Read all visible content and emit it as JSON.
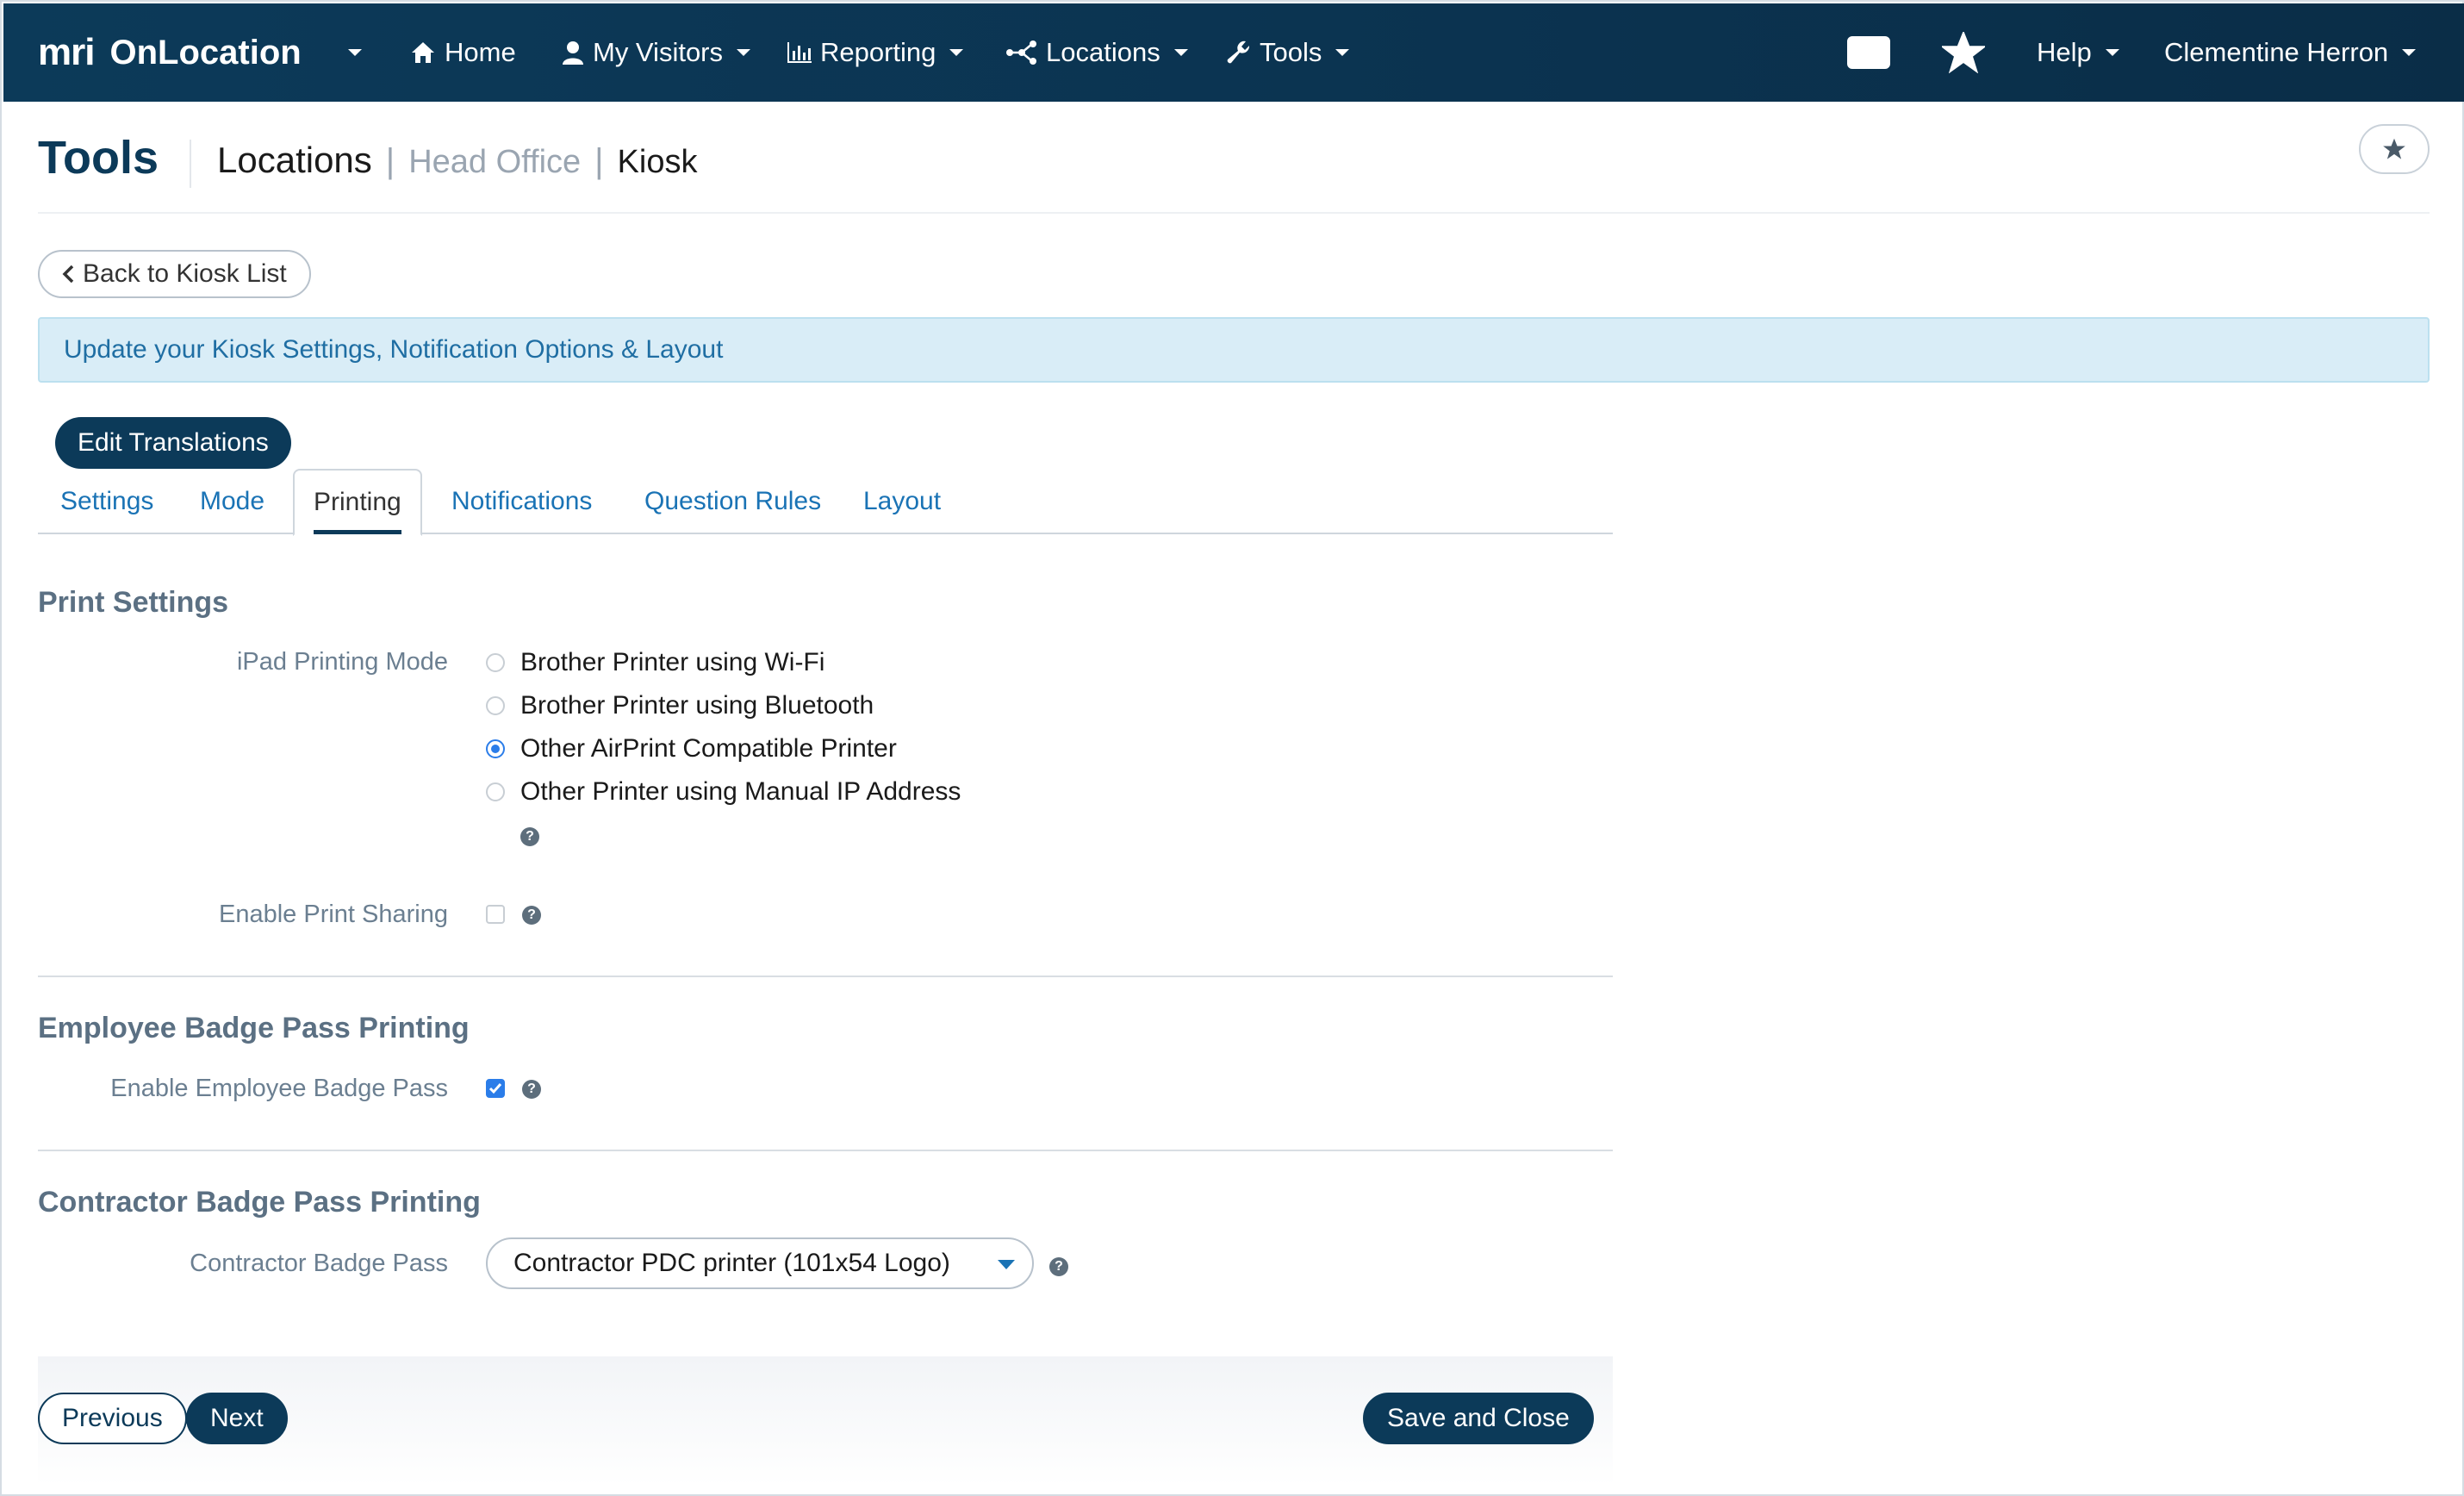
{
  "nav": {
    "logo_mark": "mri",
    "logo_text": "OnLocation",
    "home": "Home",
    "my_visitors": "My Visitors",
    "reporting": "Reporting",
    "locations": "Locations",
    "tools": "Tools",
    "help": "Help",
    "user": "Clementine Herron"
  },
  "header": {
    "title": "Tools",
    "breadcrumb_main": "Locations",
    "breadcrumb_sep": "|",
    "breadcrumb_mid": "Head Office",
    "breadcrumb_end": "Kiosk"
  },
  "back_button": "Back to Kiosk List",
  "banner": "Update your Kiosk Settings, Notification Options & Layout",
  "edit_translations": "Edit Translations",
  "tabs": [
    "Settings",
    "Mode",
    "Printing",
    "Notifications",
    "Question Rules",
    "Layout"
  ],
  "active_tab": "Printing",
  "print_settings": {
    "title": "Print Settings",
    "ipad_label": "iPad Printing Mode",
    "options": [
      "Brother Printer using Wi-Fi",
      "Brother Printer using Bluetooth",
      "Other AirPrint Compatible Printer",
      "Other Printer using Manual IP Address"
    ],
    "selected_option": "Other AirPrint Compatible Printer",
    "sharing_label": "Enable Print Sharing",
    "sharing_enabled": false
  },
  "employee_badge": {
    "title": "Employee Badge Pass Printing",
    "label": "Enable Employee Badge Pass",
    "enabled": true
  },
  "contractor_badge": {
    "title": "Contractor Badge Pass Printing",
    "label": "Contractor Badge Pass",
    "selected": "Contractor PDC printer (101x54 Logo)"
  },
  "footer": {
    "previous": "Previous",
    "next": "Next",
    "save_close": "Save and Close"
  },
  "colors": {
    "navy": "#0c3a59",
    "link": "#1a73b5",
    "accent": "#2b7de9",
    "banner_bg": "#d9edf7"
  }
}
